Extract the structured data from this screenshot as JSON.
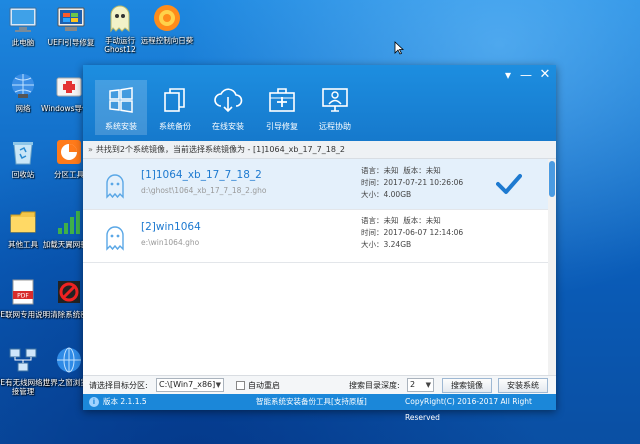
{
  "desktop": {
    "icons": [
      {
        "label": "此电脑"
      },
      {
        "label": "UEFI引导修复"
      },
      {
        "label": "手动运行Ghost12"
      },
      {
        "label": "远程控制向日葵"
      },
      {
        "label": "网络"
      },
      {
        "label": "Windows导修复"
      },
      {
        "label": "回收站"
      },
      {
        "label": "分区工具"
      },
      {
        "label": "其他工具"
      },
      {
        "label": "加载天翼网驱动"
      },
      {
        "label": "PE联网专用说明"
      },
      {
        "label": "清除系统密"
      },
      {
        "label": "PE有无线网络连接管理"
      },
      {
        "label": "世界之窗浏览器"
      }
    ]
  },
  "window": {
    "controls": {
      "menu": "▾",
      "minimize": "—",
      "close": "✕"
    },
    "toolbar": [
      {
        "label": "系统安装",
        "icon": "windows-logo-icon"
      },
      {
        "label": "系统备份",
        "icon": "copy-pages-icon"
      },
      {
        "label": "在线安装",
        "icon": "cloud-download-icon"
      },
      {
        "label": "引导修复",
        "icon": "medical-kit-icon"
      },
      {
        "label": "远程协助",
        "icon": "monitor-person-icon"
      }
    ],
    "breadcrumb": "共找到2个系统镜像，当前选择系统镜像为 - [1]1064_xb_17_7_18_2",
    "images": [
      {
        "name": "[1]1064_xb_17_7_18_2",
        "path": "d:\\ghost\\1064_xb_17_7_18_2.gho",
        "lang": "语言：未知",
        "version": "版本：未知",
        "time": "时间：2017-07-21 10:26:06",
        "size": "大小：4.00GB",
        "selected": true
      },
      {
        "name": "[2]win1064",
        "path": "e:\\win1064.gho",
        "lang": "语言：未知",
        "version": "版本：未知",
        "time": "时间：2017-06-07 12:14:06",
        "size": "大小：3.24GB",
        "selected": false
      }
    ],
    "bottom": {
      "target_label": "请选择目标分区:",
      "target_value": "C:\\[Win7_x86]",
      "auto_restart": "自动重启",
      "depth_label": "搜索目录深度:",
      "depth_value": "2",
      "search_button": "搜索镜像",
      "install_button": "安装系统"
    },
    "status": {
      "version": "版本 2.1.1.5",
      "brand": "智能系统安装备份工具[支持原版]",
      "copyright": "CopyRight(C) 2016-2017 All Right Reserved"
    }
  },
  "colors": {
    "accent": "#1b87d9",
    "link": "#1e7ad0",
    "selected_row": "#e4f0fb"
  }
}
